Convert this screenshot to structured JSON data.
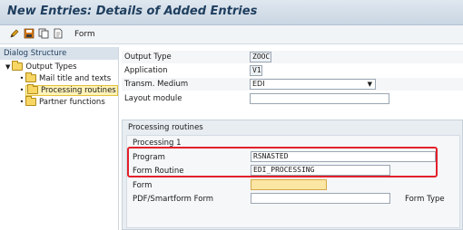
{
  "window": {
    "title": "New Entries: Details of Added Entries"
  },
  "toolbar": {
    "form_label": "Form"
  },
  "left": {
    "header": "Dialog Structure",
    "items": [
      {
        "label": "Output Types"
      },
      {
        "label": "Mail title and texts"
      },
      {
        "label": "Processing routines"
      },
      {
        "label": "Partner functions"
      }
    ]
  },
  "main": {
    "output_type_label": "Output Type",
    "output_type_value": "ZOOC",
    "application_label": "Application",
    "application_value": "V1",
    "transm_label": "Transm. Medium",
    "transm_value": "EDI",
    "layout_label": "Layout module",
    "layout_value": ""
  },
  "routines": {
    "title": "Processing routines",
    "sub_title": "Processing 1",
    "program_label": "Program",
    "program_value": "RSNASTED",
    "form_routine_label": "Form Routine",
    "form_routine_value": "EDI_PROCESSING",
    "form_label": "Form",
    "form_value": "",
    "pdf_label": "PDF/Smartform Form",
    "pdf_value": "",
    "form_type_label": "Form Type"
  },
  "colors": {
    "highlight": "#e2202b",
    "title": "#1f3e5e"
  }
}
